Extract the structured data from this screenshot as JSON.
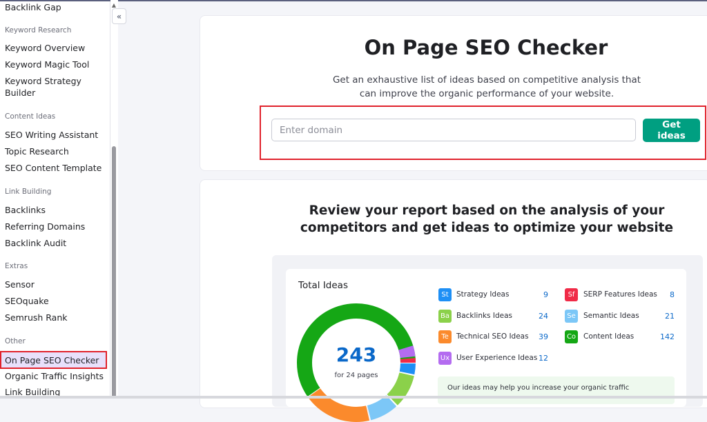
{
  "sidebar": {
    "items": [
      {
        "label": "Backlink Gap",
        "type": "item"
      },
      {
        "label": "Keyword Research",
        "type": "header"
      },
      {
        "label": "Keyword Overview",
        "type": "item"
      },
      {
        "label": "Keyword Magic Tool",
        "type": "item"
      },
      {
        "label": "Keyword Strategy Builder",
        "type": "item"
      },
      {
        "label": "Content Ideas",
        "type": "header"
      },
      {
        "label": "SEO Writing Assistant",
        "type": "item"
      },
      {
        "label": "Topic Research",
        "type": "item"
      },
      {
        "label": "SEO Content Template",
        "type": "item"
      },
      {
        "label": "Link Building",
        "type": "header"
      },
      {
        "label": "Backlinks",
        "type": "item"
      },
      {
        "label": "Referring Domains",
        "type": "item"
      },
      {
        "label": "Backlink Audit",
        "type": "item"
      },
      {
        "label": "Extras",
        "type": "header"
      },
      {
        "label": "Sensor",
        "type": "item"
      },
      {
        "label": "SEOquake",
        "type": "item"
      },
      {
        "label": "Semrush Rank",
        "type": "item"
      },
      {
        "label": "Other",
        "type": "header"
      },
      {
        "label": "On Page SEO Checker",
        "type": "active"
      },
      {
        "label": "Organic Traffic Insights",
        "type": "item"
      },
      {
        "label": "Link Building",
        "type": "item"
      }
    ],
    "collapse_icon": "double-chevron-left-icon"
  },
  "hero": {
    "title": "On Page SEO Checker",
    "subtitle": "Get an exhaustive list of ideas based on competitive analysis that can improve the organic performance of your website.",
    "input_placeholder": "Enter domain",
    "input_value": "",
    "button_label": "Get ideas"
  },
  "report": {
    "heading": "Review your report based on the analysis of your competitors and get ideas to optimize your website",
    "total_label": "Total Ideas",
    "total_value": "243",
    "total_sub": "for 24 pages",
    "legend": [
      {
        "abbr": "St",
        "label": "Strategy Ideas",
        "value": "9",
        "color": "#1e8ff5"
      },
      {
        "abbr": "Ba",
        "label": "Backlinks Ideas",
        "value": "24",
        "color": "#8bd14a"
      },
      {
        "abbr": "Te",
        "label": "Technical SEO Ideas",
        "value": "39",
        "color": "#fb8a2c"
      },
      {
        "abbr": "Ux",
        "label": "User Experience Ideas",
        "value": "12",
        "color": "#b46cf0"
      },
      {
        "abbr": "Sf",
        "label": "SERP Features Ideas",
        "value": "8",
        "color": "#f02a47"
      },
      {
        "abbr": "Se",
        "label": "Semantic Ideas",
        "value": "21",
        "color": "#7cc7f7"
      },
      {
        "abbr": "Co",
        "label": "Content Ideas",
        "value": "142",
        "color": "#15a715"
      }
    ],
    "note": "Our ideas may help you increase your organic traffic"
  }
}
